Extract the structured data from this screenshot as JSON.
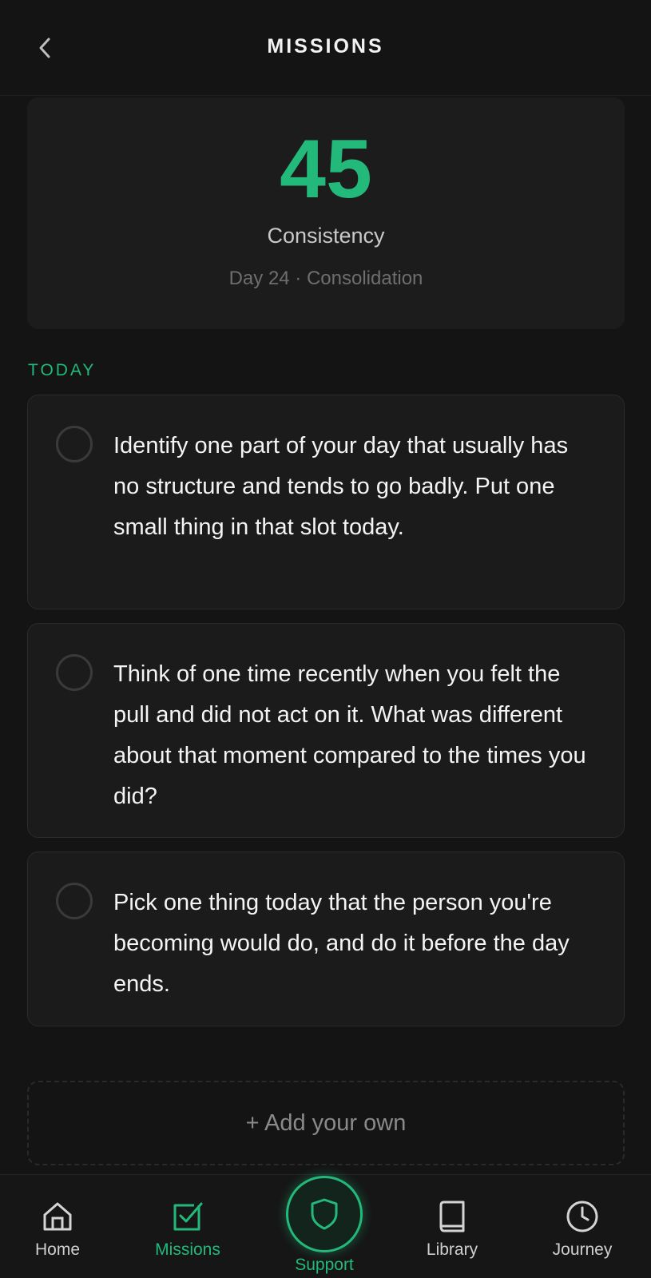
{
  "header": {
    "title": "MISSIONS",
    "back_icon": "chevron-left-icon"
  },
  "stats": {
    "value": "45",
    "label": "Consistency",
    "subtitle": "Day 24 · Consolidation"
  },
  "section": {
    "title": "TODAY"
  },
  "missions": [
    {
      "text": "Identify one part of your day that usually has no structure and tends to go badly. Put one small thing in that slot today.",
      "completed": false
    },
    {
      "text": "Think of one time recently when you felt the pull and did not act on it. What was different about that moment compared to the times you did?",
      "completed": false
    },
    {
      "text": "Pick one thing today that the person you're becoming would do, and do it before the day ends.",
      "completed": false
    }
  ],
  "add_own": {
    "label": "+ Add your own"
  },
  "nav": {
    "items": [
      {
        "label": "Home",
        "icon": "home-icon",
        "active": false
      },
      {
        "label": "Missions",
        "icon": "check-square-icon",
        "active": true
      },
      {
        "label": "Support",
        "icon": "shield-icon",
        "active": false
      },
      {
        "label": "Library",
        "icon": "book-icon",
        "active": false
      },
      {
        "label": "Journey",
        "icon": "clock-icon",
        "active": false
      }
    ]
  },
  "colors": {
    "accent": "#22b97b",
    "background": "#141414",
    "card": "#1c1c1c"
  }
}
